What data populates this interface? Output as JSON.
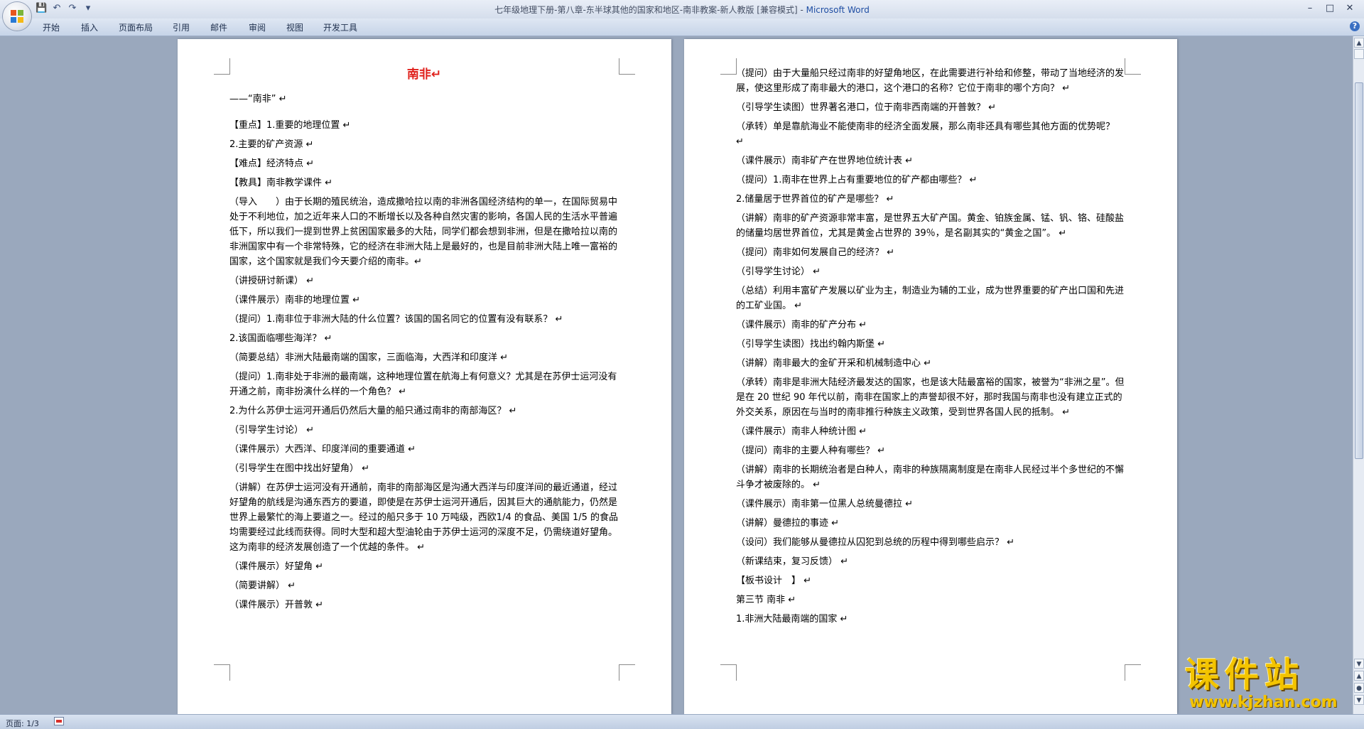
{
  "window": {
    "title_doc": "七年级地理下册-第八章-东半球其他的国家和地区-南非教案-新人教版 [兼容模式] - ",
    "title_app": "Microsoft Word"
  },
  "qat": {
    "save_icon": "💾",
    "undo_icon": "↶",
    "redo_icon": "↷",
    "more_icon": "▾"
  },
  "ribbon": {
    "tabs": [
      "开始",
      "插入",
      "页面布局",
      "引用",
      "邮件",
      "审阅",
      "视图",
      "开发工具"
    ],
    "help": "?"
  },
  "window_buttons": {
    "minimize": "–",
    "maximize": "□",
    "close": "✕"
  },
  "page1": {
    "paragraphs": [
      "南非↵",
      "——“南非” ↵",
      "【重点】1.重要的地理位置 ↵",
      "2.主要的矿产资源 ↵",
      "【难点】经济特点 ↵",
      "【教具】南非教学课件 ↵",
      "（导入　　）由于长期的殖民统治，造成撒哈拉以南的非洲各国经济结构的单一，在国际贸易中处于不利地位，加之近年来人口的不断增长以及各种自然灾害的影响，各国人民的生活水平普遍低下，所以我们一提到世界上贫困国家最多的大陆，同学们都会想到非洲，但是在撒哈拉以南的非洲国家中有一个非常特殊，它的经济在非洲大陆上是最好的，也是目前非洲大陆上唯一富裕的国家，这个国家就是我们今天要介绍的南非。↵",
      "（讲授研讨新课） ↵",
      "（课件展示）南非的地理位置 ↵",
      "（提问）1.南非位于非洲大陆的什么位置？该国的国名同它的位置有没有联系？ ↵",
      "2.该国面临哪些海洋？ ↵",
      "（简要总结）非洲大陆最南端的国家，三面临海，大西洋和印度洋 ↵",
      "（提问）1.南非处于非洲的最南端，这种地理位置在航海上有何意义？尤其是在苏伊士运河没有开通之前，南非扮演什么样的一个角色？ ↵",
      "2.为什么苏伊士运河开通后仍然后大量的船只通过南非的南部海区？ ↵",
      "（引导学生讨论） ↵",
      "（课件展示）大西洋、印度洋间的重要通道 ↵",
      "（引导学生在图中找出好望角） ↵",
      "（讲解）在苏伊士运河没有开通前，南非的南部海区是沟通大西洋与印度洋间的最近通道，经过好望角的航线是沟通东西方的要道，即使是在苏伊士运河开通后，因其巨大的通航能力，仍然是世界上最繁忙的海上要道之一。经过的船只多于 10 万吨级，西欧1/4 的食品、美国 1/5 的食品均需要经过此线而获得。同时大型和超大型油轮由于苏伊士运河的深度不足，仍需绕道好望角。这为南非的经济发展创造了一个优越的条件。 ↵",
      "（课件展示）好望角 ↵",
      "（简要讲解） ↵",
      "（课件展示）开普敦 ↵"
    ]
  },
  "page2": {
    "paragraphs": [
      "（提问）由于大量船只经过南非的好望角地区，在此需要进行补给和修整，带动了当地经济的发展，使这里形成了南非最大的港口，这个港口的名称？它位于南非的哪个方向？ ↵",
      "（引导学生读图）世界著名港口，位于南非西南端的开普敦？ ↵",
      "（承转）单是靠航海业不能使南非的经济全面发展，那么南非还具有哪些其他方面的优势呢？ ↵",
      "（课件展示）南非矿产在世界地位统计表 ↵",
      "（提问）1.南非在世界上占有重要地位的矿产都由哪些？ ↵",
      "2.储量居于世界首位的矿产是哪些？ ↵",
      "（讲解）南非的矿产资源非常丰富，是世界五大矿产国。黄金、铂族金属、锰、钒、铬、硅酸盐的储量均居世界首位，尤其是黄金占世界的 39％，是名副其实的“黄金之国”。 ↵",
      "（提问）南非如何发展自己的经济？ ↵",
      "（引导学生讨论） ↵",
      "（总结）利用丰富矿产发展以矿业为主，制造业为辅的工业，成为世界重要的矿产出口国和先进的工矿业国。 ↵",
      "（课件展示）南非的矿产分布 ↵",
      "（引导学生读图）找出约翰内斯堡 ↵",
      "（讲解）南非最大的金矿开采和机械制造中心 ↵",
      "（承转）南非是非洲大陆经济最发达的国家，也是该大陆最富裕的国家，被誉为“非洲之星”。但是在 20 世纪 90 年代以前，南非在国家上的声誉却很不好，那时我国与南非也没有建立正式的外交关系，原因在与当时的南非推行种族主义政策，受到世界各国人民的抵制。 ↵",
      "（课件展示）南非人种统计图 ↵",
      "（提问）南非的主要人种有哪些？ ↵",
      "（讲解）南非的长期统治者是白种人，南非的种族隔离制度是在南非人民经过半个多世纪的不懈斗争才被废除的。 ↵",
      "（课件展示）南非第一位黑人总统曼德拉 ↵",
      "（讲解）曼德拉的事迹 ↵",
      "（设问）我们能够从曼德拉从囚犯到总统的历程中得到哪些启示？ ↵",
      "（新课结束，复习反馈） ↵",
      "【板书设计　】 ↵",
      "第三节 南非 ↵",
      "1.非洲大陆最南端的国家 ↵"
    ]
  },
  "scrollbar": {
    "up_icon": "▲",
    "down_icon": "▼",
    "prev_page_icon": "▲",
    "select_browse_icon": "●",
    "next_page_icon": "▼"
  },
  "statusbar": {
    "page_info": "页面: 1/3"
  },
  "watermark": {
    "text": "课件站",
    "url": "www.kjzhan.com"
  }
}
